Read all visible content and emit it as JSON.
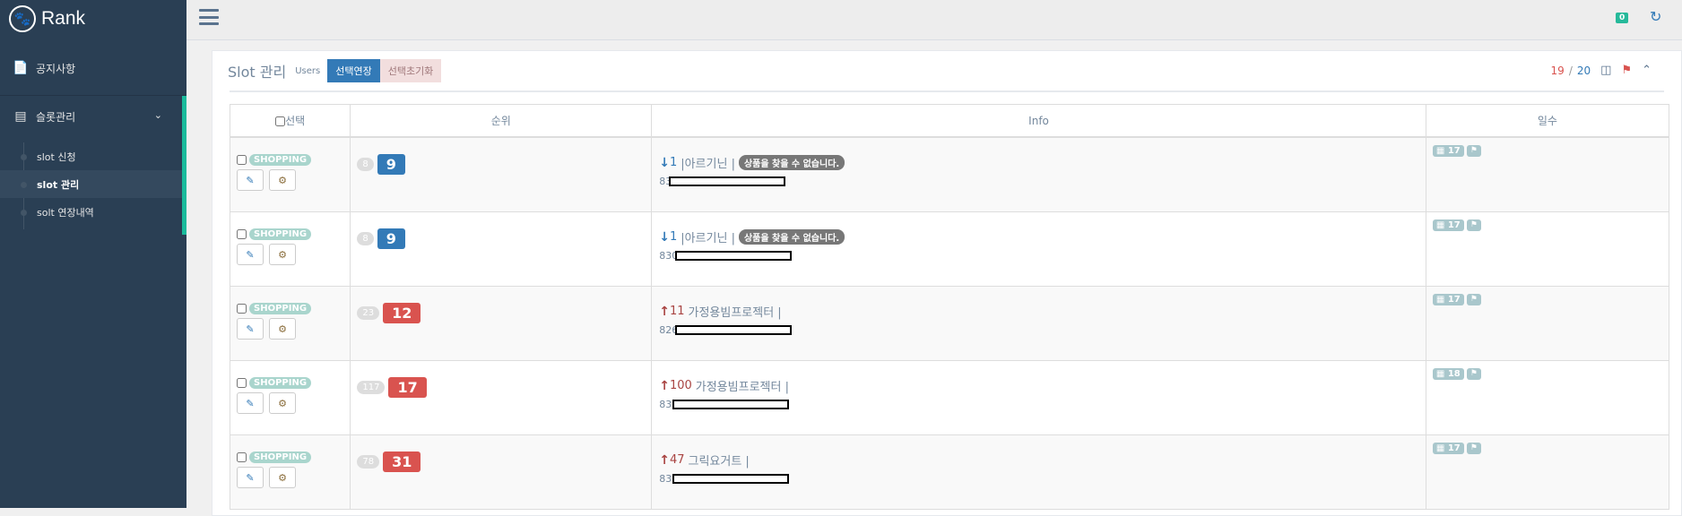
{
  "sidebar": {
    "brand": "Rank",
    "menu": [
      {
        "label": "공지사항"
      },
      {
        "label": "슬롯관리"
      }
    ],
    "submenu": [
      {
        "label": "slot 신청"
      },
      {
        "label": "slot 관리"
      },
      {
        "label": "solt 연장내역"
      }
    ]
  },
  "topbar": {
    "badge": "0"
  },
  "panel": {
    "title": "Slot 관리",
    "subtitle": "Users",
    "btn_extend": "선택연장",
    "btn_reset": "선택초기화",
    "count_used": "19",
    "count_sep": "/",
    "count_total": "20"
  },
  "table": {
    "headers": {
      "select": "선택",
      "rank": "순위",
      "info": "Info",
      "days": "일수"
    },
    "rows": [
      {
        "category": "SHOPPING",
        "prev_rank": "8",
        "rank": "9",
        "rank_color": "#337ab7",
        "direction": "down",
        "delta": "1",
        "title": "|아르기닌 |",
        "status": "상품을 찾을 수 없습니다.",
        "code_prefix": "83",
        "days": "17"
      },
      {
        "category": "SHOPPING",
        "prev_rank": "8",
        "rank": "9",
        "rank_color": "#337ab7",
        "direction": "down",
        "delta": "1",
        "title": "|아르기닌 |",
        "status": "상품을 찾을 수 없습니다.",
        "code_prefix": "830",
        "days": "17"
      },
      {
        "category": "SHOPPING",
        "prev_rank": "23",
        "rank": "12",
        "rank_color": "#d9534f",
        "direction": "up",
        "delta": "11",
        "title": "가정용빔프로젝터 |",
        "status": "",
        "code_prefix": "826",
        "days": "17"
      },
      {
        "category": "SHOPPING",
        "prev_rank": "117",
        "rank": "17",
        "rank_color": "#d9534f",
        "direction": "up",
        "delta": "100",
        "title": "가정용빔프로젝터 |",
        "status": "",
        "code_prefix": "83:",
        "days": "18"
      },
      {
        "category": "SHOPPING",
        "prev_rank": "78",
        "rank": "31",
        "rank_color": "#d9534f",
        "direction": "up",
        "delta": "47",
        "title": "그릭요거트 |",
        "status": "",
        "code_prefix": "83:",
        "days": "17"
      }
    ]
  },
  "colors": {
    "sidebar_bg": "#2a3f54",
    "accent": "#1abb9c",
    "primary": "#337ab7",
    "danger": "#d9534f"
  }
}
